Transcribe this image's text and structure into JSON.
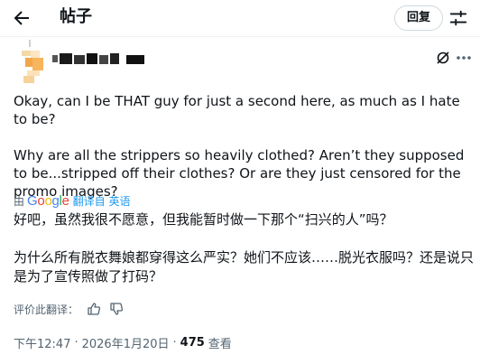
{
  "header": {
    "title": "帖子",
    "reply_label": "回复"
  },
  "icons": {
    "back": "arrow-left-icon",
    "settings": "sliders-icon",
    "grok": "grok-icon",
    "more": "more-horizontal-icon"
  },
  "post": {
    "text": "Okay, can I be THAT guy for just a second here, as much as I hate to be?\n\nWhy are all the strippers so heavily clothed? Aren’t they supposed to be...stripped off their clothes? Or are they just censored for the promo images?",
    "translated_by_prefix": "由",
    "google_label": "Google",
    "translated_from_label": "翻译自 英语",
    "translated_text": "好吧，虽然我很不愿意，但我能暂时做一下那个“扫兴的人”吗？\n\n为什么所有脱衣舞娘都穿得这么严实？她们不应该……脱光衣服吗？还是说只是为了宣传照做了打码？",
    "rate_label": "评价此翻译：",
    "time": "下午12:47",
    "date": "2026年1月20日",
    "separator": "·",
    "views_count": "475",
    "views_label": "查看"
  },
  "colors": {
    "text": "#0f1419",
    "secondary": "#536471",
    "link": "#1d9bf0",
    "border": "#cfd9de"
  }
}
